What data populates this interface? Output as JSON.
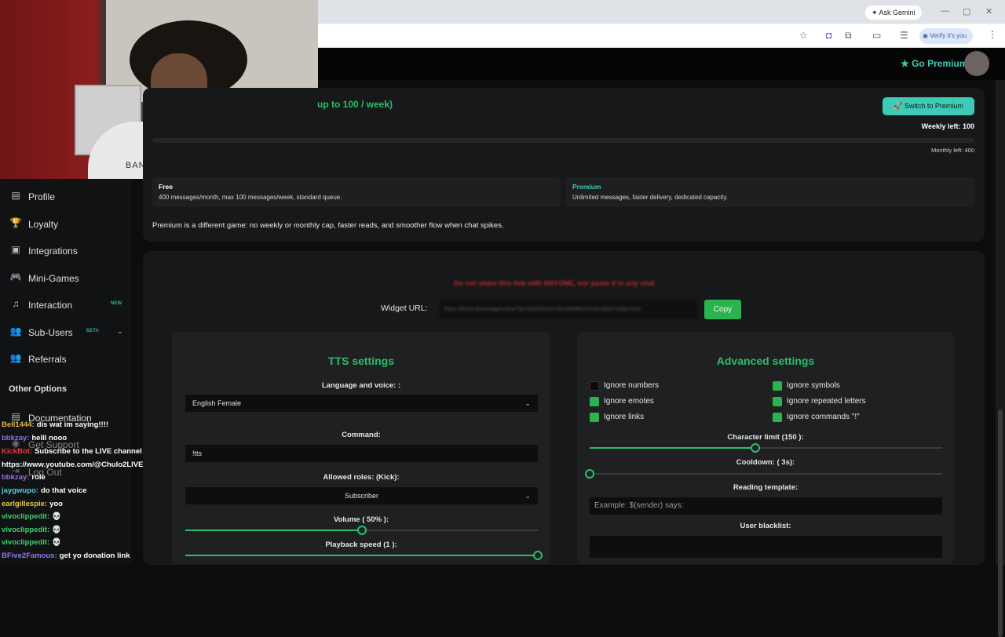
{
  "browser": {
    "ask_gemini": "✦ Ask Gemini",
    "verify": "Verify it's you",
    "window_controls": [
      "⌄",
      "—",
      "▢",
      "✕"
    ]
  },
  "webcam": {
    "shirt_text": "BANANA REPUBLIC"
  },
  "topbar": {
    "go_premium": "★ Go Premium"
  },
  "plan": {
    "title": "up to 100 / week)",
    "switch_button": "🚀 Switch to Premium",
    "weekly_left": "Weekly left: 100",
    "monthly_left": "Monthly left: 400",
    "free": {
      "title": "Free",
      "desc": "400 messages/month, max 100 messages/week, standard queue."
    },
    "premium": {
      "title": "Premium",
      "desc": "Unlimited messages, faster delivery, dedicated capacity."
    },
    "note": "Premium is a different game: no weekly or monthly cap, faster reads, and smoother flow when chat spikes."
  },
  "widget": {
    "warning": "Do not share this link with ANYONE, nor paste it in any chat",
    "label": "Widget URL:",
    "url": "https://botrix.live/widgets/ttsw?bu=5b9cf3a1e7d2c04b86e2f1a9c3d5b7e0&p=kick",
    "copy": "Copy"
  },
  "tts": {
    "title": "TTS settings",
    "language_label": "Language and voice: :",
    "language_value": "English Female",
    "command_label": "Command:",
    "command_value": "!tts",
    "roles_label": "Allowed roles: (Kick):",
    "roles_value": "Subscriber",
    "volume_label": "Volume ( 50% ):",
    "volume": 0.5,
    "speed_label": "Playback speed (1 ):",
    "speed": 1.0
  },
  "advanced": {
    "title": "Advanced settings",
    "checks": [
      {
        "label": "Ignore numbers",
        "checked": false
      },
      {
        "label": "Ignore symbols",
        "checked": true
      },
      {
        "label": "Ignore emotes",
        "checked": true
      },
      {
        "label": "Ignore repeated letters",
        "checked": true
      },
      {
        "label": "Ignore links",
        "checked": true
      },
      {
        "label": "Ignore commands \"!\"",
        "checked": true
      }
    ],
    "char_limit_label": "Character limit (150 ):",
    "char_limit": 0.47,
    "cooldown_label": "Cooldown: ( 3s):",
    "cooldown": 0.0,
    "template_label": "Reading template:",
    "template_placeholder": "Example: $(sender) says:",
    "blacklist_label": "User blacklist:"
  },
  "sidebar": {
    "items": [
      {
        "icon": "▤",
        "label": "Profile"
      },
      {
        "icon": "🏆",
        "label": "Loyalty"
      },
      {
        "icon": "▣",
        "label": "Integrations"
      },
      {
        "icon": "🎮",
        "label": "Mini-Games"
      },
      {
        "icon": "♫",
        "label": "Interaction",
        "tag": "NEW"
      },
      {
        "icon": "👥",
        "label": "Sub-Users",
        "tag": "BETA"
      },
      {
        "icon": "👥",
        "label": "Referrals"
      }
    ],
    "other_options": "Other Options",
    "documentation": "Documentation",
    "get_support": "Get Support",
    "log_out": "Log Out"
  },
  "chat": [
    {
      "user": "Bell1444:",
      "msg": "dis wat im saying!!!!",
      "color": "#e8b44a"
    },
    {
      "user": "bbkzay:",
      "msg": "helll nooo",
      "color": "#9a6cf0"
    },
    {
      "user": "KickBot:",
      "msg": "Subscribe to the LIVE channel",
      "color": "#e04040"
    },
    {
      "user": "",
      "msg": "https://www.youtube.com/@Chulo2LIVE",
      "color": "#ffffff"
    },
    {
      "user": "bbkzay:",
      "msg": "role",
      "color": "#9a6cf0"
    },
    {
      "user": "jaygwupo:",
      "msg": "do that voice",
      "color": "#4fd4e0"
    },
    {
      "user": "earlgillespie:",
      "msg": "yoo",
      "color": "#e8c84a"
    },
    {
      "user": "vivoclippedit:",
      "msg": "💀",
      "color": "#40d070"
    },
    {
      "user": "vivoclippedit:",
      "msg": "💀",
      "color": "#40d070"
    },
    {
      "user": "vivoclippedit:",
      "msg": "💀",
      "color": "#40d070"
    },
    {
      "user": "BFive2Famous:",
      "msg": "get yo donation link",
      "color": "#8a7cf0"
    }
  ]
}
